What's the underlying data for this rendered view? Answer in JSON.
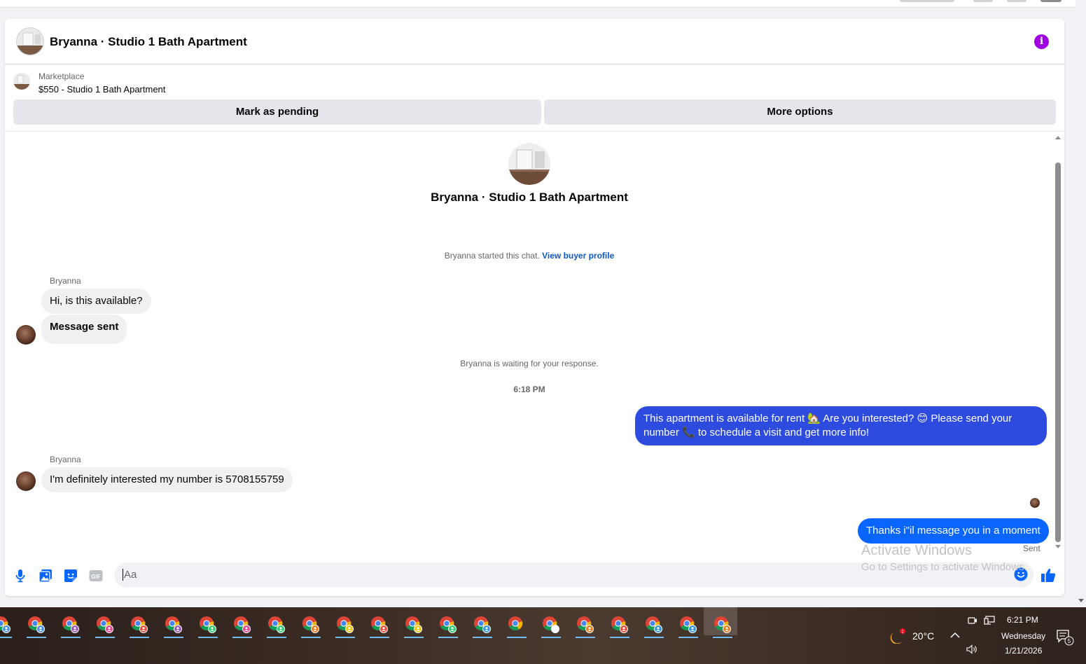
{
  "header": {
    "title": "Bryanna · Studio 1 Bath Apartment",
    "info_icon": "info-icon",
    "info_glyph": "i",
    "accent_color": "#a100e0"
  },
  "marketplace": {
    "label": "Marketplace",
    "listing": "$550 - Studio 1 Bath Apartment",
    "mark_pending_label": "Mark as pending",
    "more_options_label": "More options"
  },
  "thread": {
    "title": "Bryanna · Studio 1 Bath Apartment",
    "started_text": "Bryanna started this chat.",
    "view_profile_link": "View buyer profile",
    "waiting_text": "Bryanna is waiting for your response.",
    "timestamp": "6:18 PM",
    "messages": [
      {
        "sender": "Bryanna",
        "direction": "incoming",
        "text": "Hi, is this available?"
      },
      {
        "sender": "Bryanna",
        "direction": "incoming",
        "text": "Message sent"
      },
      {
        "sender": "me",
        "direction": "outgoing",
        "text": "This apartment is available for rent 🏡 Are you interested? 😊 Please send your number 📞 to schedule a visit and get more info!"
      },
      {
        "sender": "Bryanna",
        "direction": "incoming",
        "text": "I'm definitely interested my number is 5708155759"
      },
      {
        "sender": "me",
        "direction": "outgoing",
        "text": "Thanks i\"il message you in a moment"
      }
    ],
    "sent_status": "Sent",
    "outgoing_color": "#0866ff"
  },
  "composer": {
    "placeholder": "Aa",
    "tools": [
      "microphone-icon",
      "photo-icon",
      "sticker-icon",
      "gif-icon"
    ],
    "gif_label": "GIF",
    "emoji_icon": "emoji-icon",
    "like_icon": "thumbs-up-icon"
  },
  "watermark": {
    "line1": "Activate Windows",
    "line2": "Go to Settings to activate Windows."
  },
  "taskbar": {
    "weather_temp": "20°C",
    "weather_alert_count": "1",
    "time": "6:21 PM",
    "day": "Wednesday",
    "date": "1/21/2026",
    "notification_count": "5",
    "profile_colors": [
      "#4a90e2",
      "#4a90e2",
      "#9b59b6",
      "#e84393",
      "#e74c3c",
      "#9b59b6",
      "#2ecc71",
      "#e84393",
      "#2ecc71",
      "#e67e22",
      "#f1c40f",
      "#e74c3c",
      "#f1c40f",
      "#2ecc71",
      "#3498db",
      "#27ae60",
      "#ffffff",
      "#e67e22",
      "#e74c3c",
      "#3498db",
      "#3498db",
      "#e67e22"
    ]
  }
}
